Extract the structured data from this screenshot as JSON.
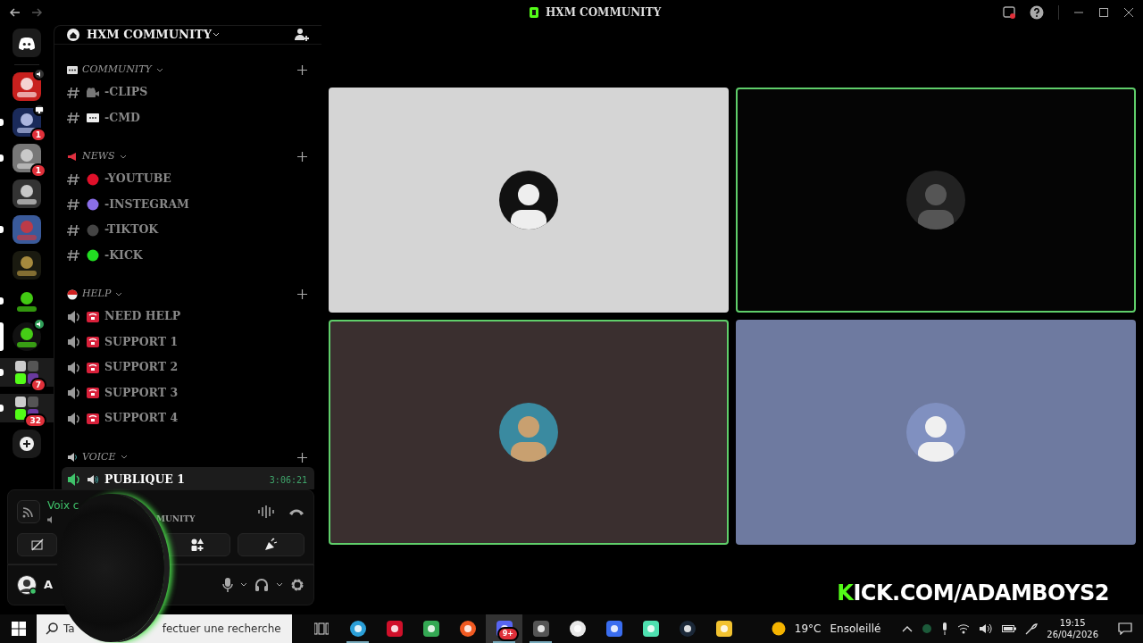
{
  "titlebar": {
    "title": "HXM COMMUNITY"
  },
  "servers": [
    {
      "kind": "home",
      "selected": false,
      "unread": false
    },
    {
      "kind": "picture",
      "selected": false,
      "unread": false,
      "in_voice": true
    },
    {
      "kind": "picture",
      "selected": false,
      "unread": true,
      "sharing_screen": true,
      "badge": "1"
    },
    {
      "kind": "picture",
      "selected": false,
      "unread": true,
      "badge": "1"
    },
    {
      "kind": "picture",
      "selected": false,
      "unread": false
    },
    {
      "kind": "picture",
      "selected": false,
      "unread": true
    },
    {
      "kind": "picture",
      "selected": false,
      "unread": false
    },
    {
      "kind": "picture",
      "selected": false,
      "unread": true
    },
    {
      "kind": "picture",
      "selected": true,
      "unread": false,
      "in_voice": true
    },
    {
      "kind": "folder",
      "selected": false,
      "unread": true,
      "badge": "7"
    },
    {
      "kind": "folder",
      "selected": false,
      "unread": true,
      "badge": "32"
    },
    {
      "kind": "add",
      "selected": false,
      "unread": false
    }
  ],
  "server_header": {
    "name": "HXM COMMUNITY"
  },
  "categories": [
    {
      "name": "COMMUNITY",
      "channels": [
        {
          "kind": "text",
          "name": "-CLIPS",
          "selected": false
        },
        {
          "kind": "text",
          "name": "-CMD",
          "selected": false
        }
      ]
    },
    {
      "name": "NEWS",
      "channels": [
        {
          "kind": "text",
          "color": "#e0102a",
          "name": "-YOUTUBE",
          "selected": false
        },
        {
          "kind": "text",
          "color": "#8a6ee8",
          "name": "-INSTEGRAM",
          "selected": false
        },
        {
          "kind": "text",
          "color": "#444444",
          "name": "-TIKTOK",
          "selected": false
        },
        {
          "kind": "text",
          "color": "#22dd22",
          "name": "-KICK",
          "selected": false
        }
      ]
    },
    {
      "name": "HELP",
      "channels": [
        {
          "kind": "voice",
          "name": "NEED HELP",
          "selected": false
        },
        {
          "kind": "voice",
          "name": "SUPPORT 1",
          "selected": false
        },
        {
          "kind": "voice",
          "name": "SUPPORT 2",
          "selected": false
        },
        {
          "kind": "voice",
          "name": "SUPPORT 3",
          "selected": false
        },
        {
          "kind": "voice",
          "name": "SUPPORT 4",
          "selected": false
        }
      ]
    },
    {
      "name": "VOICE",
      "channels": [
        {
          "kind": "voice",
          "name": "PUBLIQUE 1",
          "selected": true,
          "time": "3:06:21"
        }
      ]
    }
  ],
  "voice_panel": {
    "status": "Voix c",
    "server": "MUNITY"
  },
  "user_panel": {
    "name": "A"
  },
  "tiles": [
    {
      "color": "#d5d5d5",
      "speaking": false
    },
    {
      "color": "#050505",
      "speaking": true
    },
    {
      "color": "#3a2f2f",
      "speaking": true
    },
    {
      "color": "#6e7aa0",
      "speaking": false
    }
  ],
  "overlay": {
    "text": "KICK.COM/ADAMBOYS2"
  },
  "taskbar": {
    "search_start": "Ta",
    "search_end": "fectuer une recherche",
    "apps": [
      {
        "color": "#2a9fd8",
        "selected": false,
        "running": true
      },
      {
        "color": "#d0102a",
        "selected": false,
        "running": false
      },
      {
        "color": "#34a853",
        "selected": false,
        "running": false
      },
      {
        "color": "#f05a22",
        "selected": false,
        "running": false
      },
      {
        "color": "#5865f2",
        "selected": true,
        "running": true,
        "badge": "9+"
      },
      {
        "color": "#555555",
        "selected": false,
        "running": true
      },
      {
        "color": "#e8e8e8",
        "selected": false,
        "running": false
      },
      {
        "color": "#3a6df0",
        "selected": false,
        "running": false
      },
      {
        "color": "#4ee0b0",
        "selected": false,
        "running": false
      },
      {
        "color": "#1b2838",
        "selected": false,
        "running": false
      },
      {
        "color": "#f2c230",
        "selected": false,
        "running": false
      }
    ],
    "temperature": "19°C",
    "weather": "Ensoleillé",
    "time": "19:15",
    "date": "26/04/2026"
  }
}
